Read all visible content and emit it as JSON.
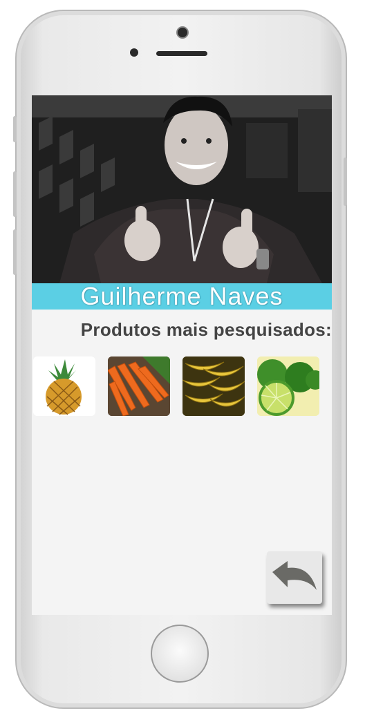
{
  "profile": {
    "name": "Guilherme Naves"
  },
  "section": {
    "title": "Produtos mais pesquisados:"
  },
  "products": [
    {
      "icon": "pineapple-image"
    },
    {
      "icon": "carrots-image"
    },
    {
      "icon": "bananas-image"
    },
    {
      "icon": "limes-image"
    }
  ],
  "controls": {
    "undo_icon": "undo-arrow-icon"
  },
  "colors": {
    "name_bar": "#5bcfe4",
    "title_text": "#444444"
  }
}
